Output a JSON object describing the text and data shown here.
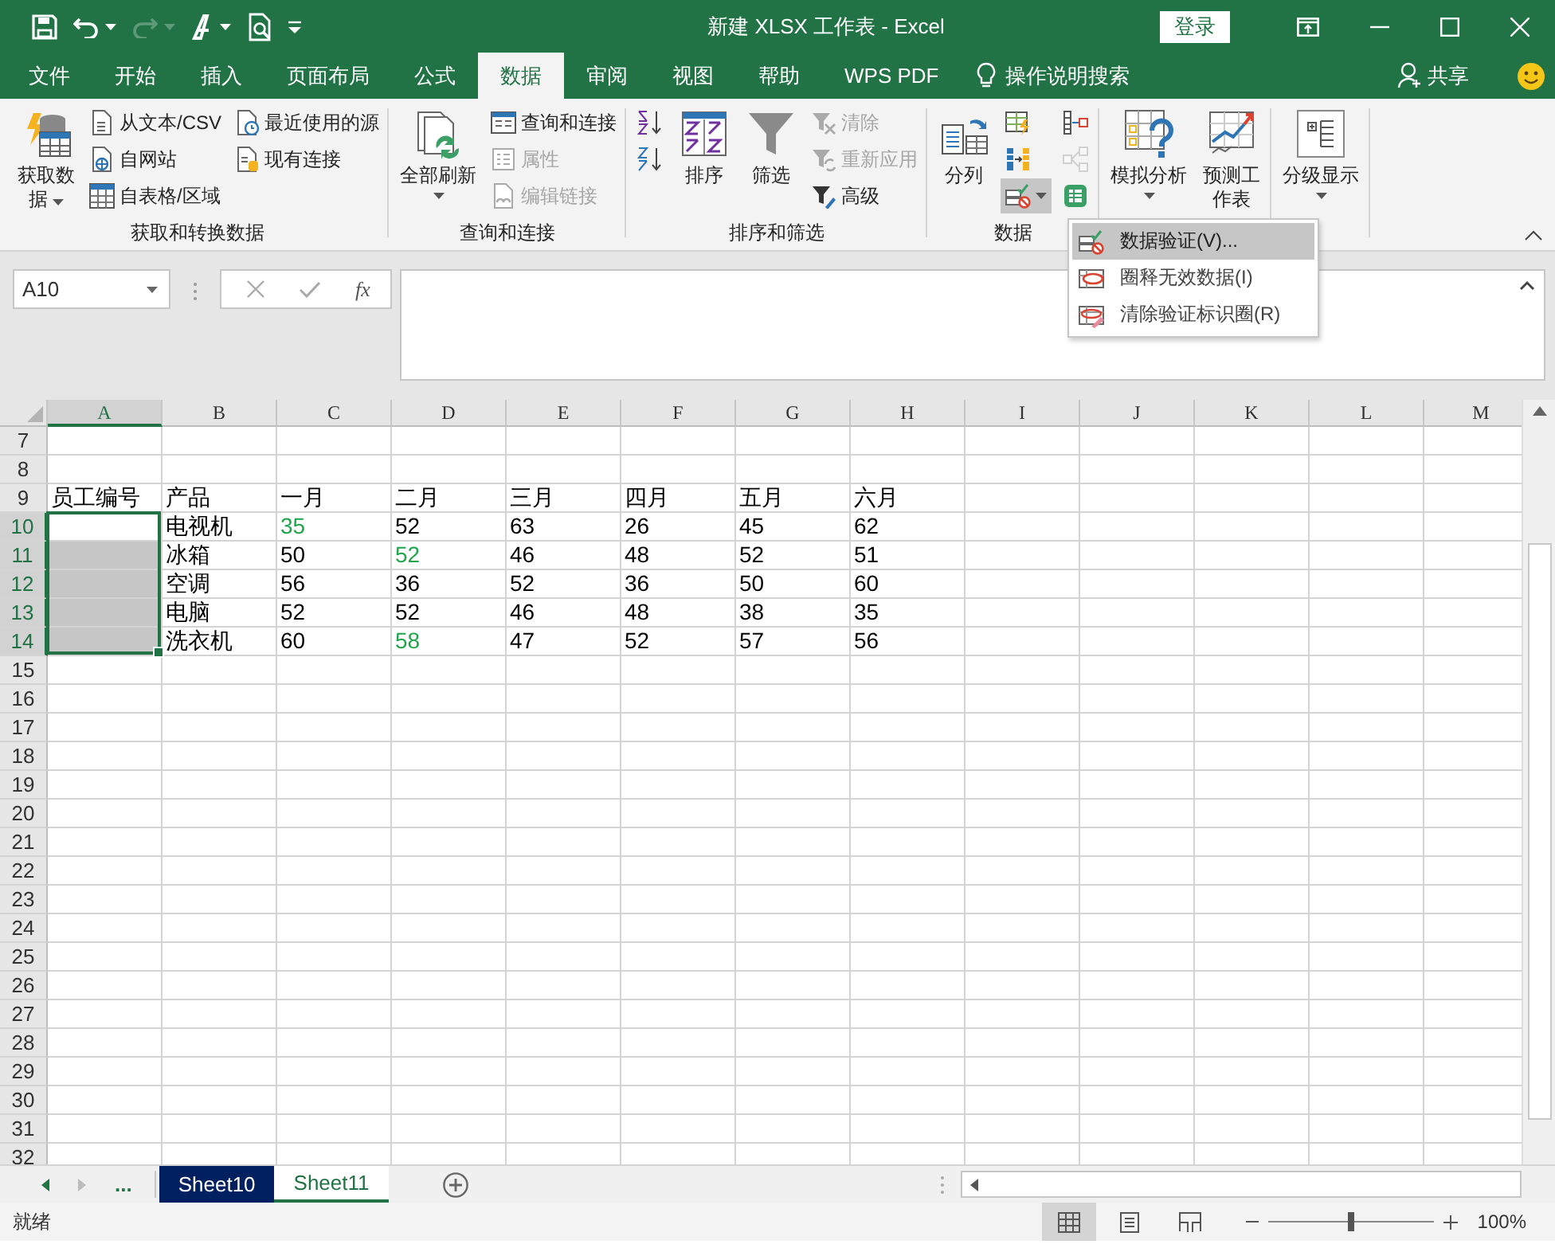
{
  "window": {
    "title": "新建 XLSX 工作表 - Excel",
    "sign_in": "登录"
  },
  "tabs": [
    {
      "label": "文件",
      "selected": false
    },
    {
      "label": "开始",
      "selected": false
    },
    {
      "label": "插入",
      "selected": false
    },
    {
      "label": "页面布局",
      "selected": false
    },
    {
      "label": "公式",
      "selected": false
    },
    {
      "label": "数据",
      "selected": true
    },
    {
      "label": "审阅",
      "selected": false
    },
    {
      "label": "视图",
      "selected": false
    },
    {
      "label": "帮助",
      "selected": false
    },
    {
      "label": "WPS PDF",
      "selected": false
    }
  ],
  "tell_me": "操作说明搜索",
  "share": "共享",
  "ribbon": {
    "groups": [
      {
        "label": "获取和转换数据",
        "items": [
          {
            "kind": "large",
            "label": "获取数据",
            "dropdown": true,
            "disabled": false,
            "pressed": false
          },
          {
            "kind": "small",
            "label": "从文本/CSV",
            "dropdown": false,
            "disabled": false,
            "pressed": false
          },
          {
            "kind": "small",
            "label": "自网站",
            "dropdown": false,
            "disabled": false,
            "pressed": false
          },
          {
            "kind": "small",
            "label": "自表格/区域",
            "dropdown": false,
            "disabled": false,
            "pressed": false
          },
          {
            "kind": "small",
            "label": "最近使用的源",
            "dropdown": false,
            "disabled": false,
            "pressed": false
          },
          {
            "kind": "small",
            "label": "现有连接",
            "dropdown": false,
            "disabled": false,
            "pressed": false
          }
        ]
      },
      {
        "label": "查询和连接",
        "items": [
          {
            "kind": "large",
            "label": "全部刷新",
            "dropdown": true,
            "disabled": false,
            "pressed": false
          },
          {
            "kind": "small",
            "label": "查询和连接",
            "dropdown": false,
            "disabled": false,
            "pressed": false
          },
          {
            "kind": "small",
            "label": "属性",
            "dropdown": false,
            "disabled": true,
            "pressed": false
          },
          {
            "kind": "small",
            "label": "编辑链接",
            "dropdown": false,
            "disabled": true,
            "pressed": false
          }
        ]
      },
      {
        "label": "排序和筛选",
        "items": [
          {
            "kind": "icon",
            "dropdown": false,
            "disabled": false,
            "pressed": false
          },
          {
            "kind": "icon",
            "dropdown": false,
            "disabled": false,
            "pressed": false
          },
          {
            "kind": "large",
            "label": "排序",
            "dropdown": false,
            "disabled": false,
            "pressed": false
          },
          {
            "kind": "large",
            "label": "筛选",
            "dropdown": false,
            "disabled": false,
            "pressed": false
          },
          {
            "kind": "small",
            "label": "清除",
            "dropdown": false,
            "disabled": true,
            "pressed": false
          },
          {
            "kind": "small",
            "label": "重新应用",
            "dropdown": false,
            "disabled": true,
            "pressed": false
          },
          {
            "kind": "small",
            "label": "高级",
            "dropdown": false,
            "disabled": false,
            "pressed": false
          }
        ]
      },
      {
        "label": "数据",
        "items": [
          {
            "kind": "large",
            "label": "分列",
            "dropdown": false,
            "disabled": false,
            "pressed": false
          },
          {
            "kind": "icon",
            "dropdown": false,
            "disabled": false,
            "pressed": false
          },
          {
            "kind": "icon",
            "dropdown": false,
            "disabled": false,
            "pressed": false
          },
          {
            "kind": "icon",
            "dropdown": true,
            "disabled": false,
            "pressed": true
          },
          {
            "kind": "icon",
            "dropdown": false,
            "disabled": false,
            "pressed": false
          },
          {
            "kind": "icon",
            "dropdown": false,
            "disabled": true,
            "pressed": false
          },
          {
            "kind": "icon",
            "dropdown": false,
            "disabled": false,
            "pressed": false
          }
        ]
      },
      {
        "items": [
          {
            "kind": "large",
            "label": "模拟分析",
            "dropdown": true,
            "disabled": false,
            "pressed": false
          },
          {
            "kind": "large",
            "label": "预测工作表",
            "dropdown": false,
            "disabled": false,
            "pressed": false
          }
        ]
      },
      {
        "items": [
          {
            "kind": "large",
            "label": "分级显示",
            "dropdown": true,
            "disabled": false,
            "pressed": false
          }
        ]
      }
    ]
  },
  "dropdown_menu": {
    "items": [
      {
        "label": "数据验证(V)...",
        "selected": true
      },
      {
        "label": "圈释无效数据(I)",
        "selected": false
      },
      {
        "label": "清除验证标识圈(R)",
        "selected": false
      }
    ]
  },
  "formula_bar": {
    "name_box": "A10",
    "function_button": "fx"
  },
  "sheet": {
    "columns": [
      {
        "label": "A",
        "selected": true
      },
      {
        "label": "B",
        "selected": false
      },
      {
        "label": "C",
        "selected": false
      },
      {
        "label": "D",
        "selected": false
      },
      {
        "label": "E",
        "selected": false
      },
      {
        "label": "F",
        "selected": false
      },
      {
        "label": "G",
        "selected": false
      },
      {
        "label": "H",
        "selected": false
      },
      {
        "label": "I",
        "selected": false
      },
      {
        "label": "J",
        "selected": false
      },
      {
        "label": "K",
        "selected": false
      },
      {
        "label": "L",
        "selected": false
      },
      {
        "label": "M",
        "selected": false
      }
    ],
    "rows": [
      {
        "number": "7",
        "selected": false
      },
      {
        "number": "8",
        "selected": false
      },
      {
        "number": "9",
        "selected": false,
        "cells": [
          {
            "text": "员工编号",
            "flagged": false
          },
          {
            "text": "产品",
            "flagged": false
          },
          {
            "text": "一月",
            "flagged": false
          },
          {
            "text": "二月",
            "flagged": false
          },
          {
            "text": "三月",
            "flagged": false
          },
          {
            "text": "四月",
            "flagged": false
          },
          {
            "text": "五月",
            "flagged": false
          },
          {
            "text": "六月",
            "flagged": false
          }
        ]
      },
      {
        "number": "10",
        "selected": true,
        "cells": [
          null,
          {
            "text": "电视机",
            "flagged": false
          },
          {
            "text": "35",
            "flagged": true
          },
          {
            "text": "52",
            "flagged": false
          },
          {
            "text": "63",
            "flagged": false
          },
          {
            "text": "26",
            "flagged": false
          },
          {
            "text": "45",
            "flagged": false
          },
          {
            "text": "62",
            "flagged": false
          }
        ]
      },
      {
        "number": "11",
        "selected": true,
        "cells": [
          null,
          {
            "text": "冰箱",
            "flagged": false
          },
          {
            "text": "50",
            "flagged": false
          },
          {
            "text": "52",
            "flagged": true
          },
          {
            "text": "46",
            "flagged": false
          },
          {
            "text": "48",
            "flagged": false
          },
          {
            "text": "52",
            "flagged": false
          },
          {
            "text": "51",
            "flagged": false
          }
        ]
      },
      {
        "number": "12",
        "selected": true,
        "cells": [
          null,
          {
            "text": "空调",
            "flagged": false
          },
          {
            "text": "56",
            "flagged": false
          },
          {
            "text": "36",
            "flagged": false
          },
          {
            "text": "52",
            "flagged": false
          },
          {
            "text": "36",
            "flagged": false
          },
          {
            "text": "50",
            "flagged": false
          },
          {
            "text": "60",
            "flagged": false
          }
        ]
      },
      {
        "number": "13",
        "selected": true,
        "cells": [
          null,
          {
            "text": "电脑",
            "flagged": false
          },
          {
            "text": "52",
            "flagged": false
          },
          {
            "text": "52",
            "flagged": false
          },
          {
            "text": "46",
            "flagged": false
          },
          {
            "text": "48",
            "flagged": false
          },
          {
            "text": "38",
            "flagged": false
          },
          {
            "text": "35",
            "flagged": false
          }
        ]
      },
      {
        "number": "14",
        "selected": true,
        "cells": [
          null,
          {
            "text": "洗衣机",
            "flagged": false
          },
          {
            "text": "60",
            "flagged": false
          },
          {
            "text": "58",
            "flagged": true
          },
          {
            "text": "47",
            "flagged": false
          },
          {
            "text": "52",
            "flagged": false
          },
          {
            "text": "57",
            "flagged": false
          },
          {
            "text": "56",
            "flagged": false
          }
        ]
      },
      {
        "number": "15",
        "selected": false
      },
      {
        "number": "16",
        "selected": false
      },
      {
        "number": "17",
        "selected": false
      },
      {
        "number": "18",
        "selected": false
      },
      {
        "number": "19",
        "selected": false
      },
      {
        "number": "20",
        "selected": false
      },
      {
        "number": "21",
        "selected": false
      },
      {
        "number": "22",
        "selected": false
      },
      {
        "number": "23",
        "selected": false
      },
      {
        "number": "24",
        "selected": false
      },
      {
        "number": "25",
        "selected": false
      },
      {
        "number": "26",
        "selected": false
      },
      {
        "number": "27",
        "selected": false
      },
      {
        "number": "28",
        "selected": false
      },
      {
        "number": "29",
        "selected": false
      },
      {
        "number": "30",
        "selected": false
      },
      {
        "number": "31",
        "selected": false
      },
      {
        "number": "32",
        "selected": false
      }
    ]
  },
  "sheet_tabs": {
    "overflow": "...",
    "sheets": [
      {
        "name": "Sheet10",
        "selected": false,
        "color": "#002060"
      },
      {
        "name": "Sheet11",
        "selected": true
      }
    ]
  },
  "status_bar": {
    "status": "就绪",
    "views": [
      {
        "kind": "normal",
        "selected": true
      },
      {
        "kind": "page-layout",
        "selected": false
      },
      {
        "kind": "page-break",
        "selected": false
      }
    ],
    "zoom": {
      "level": 0.5,
      "reading": "100%"
    }
  }
}
